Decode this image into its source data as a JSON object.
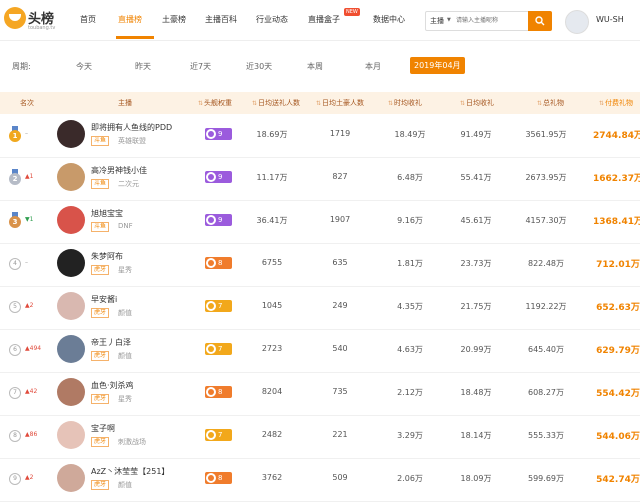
{
  "header": {
    "logo_name": "头榜",
    "logo_sub": "toubang.tv",
    "nav": [
      {
        "label": "首页",
        "active": false
      },
      {
        "label": "直播榜",
        "active": true
      },
      {
        "label": "土豪榜",
        "active": false
      },
      {
        "label": "主播百科",
        "active": false
      },
      {
        "label": "行业动态",
        "active": false
      },
      {
        "label": "直播盒子",
        "active": false,
        "badge": "NEW"
      },
      {
        "label": "数据中心",
        "active": false
      }
    ],
    "search": {
      "type": "主播",
      "placeholder": "请输入主播昵称"
    },
    "user_name": "WU-SH"
  },
  "period": {
    "label": "周期:",
    "options": [
      "今天",
      "昨天",
      "近7天",
      "近30天",
      "本周",
      "本月",
      "2019年04月"
    ],
    "selected_index": 6
  },
  "table": {
    "columns": [
      "名次",
      "主播",
      "头舰权重",
      "日均送礼人数",
      "日均土豪人数",
      "时均收礼",
      "日均收礼",
      "总礼物",
      "付费礼物"
    ],
    "rows": [
      {
        "rank": "1",
        "trend": "–",
        "trend_dir": "flat",
        "name": "即将拥有人鱼线的PDD",
        "platform": "斗鱼",
        "category": "英雄联盟",
        "weight": "9",
        "weight_color": "purple",
        "gift_users": "18.69万",
        "rich_users": "1719",
        "hourly": "18.49万",
        "daily": "91.49万",
        "total": "3561.95万",
        "paid": "2744.84万",
        "avatar_color": "#3a2a2a"
      },
      {
        "rank": "2",
        "trend": "1",
        "trend_dir": "up",
        "name": "高冷男神钱小佳",
        "platform": "斗鱼",
        "category": "二次元",
        "weight": "9",
        "weight_color": "purple",
        "gift_users": "11.17万",
        "rich_users": "827",
        "hourly": "6.48万",
        "daily": "55.41万",
        "total": "2673.95万",
        "paid": "1662.37万",
        "avatar_color": "#c89a6a"
      },
      {
        "rank": "3",
        "trend": "1",
        "trend_dir": "down",
        "name": "旭旭宝宝",
        "platform": "斗鱼",
        "category": "DNF",
        "weight": "9",
        "weight_color": "purple",
        "gift_users": "36.41万",
        "rich_users": "1907",
        "hourly": "9.16万",
        "daily": "45.61万",
        "total": "4157.30万",
        "paid": "1368.41万",
        "avatar_color": "#d8534a"
      },
      {
        "rank": "4",
        "trend": "–",
        "trend_dir": "flat",
        "name": "朱梦阿布",
        "platform": "虎牙",
        "category": "星秀",
        "weight": "8",
        "weight_color": "orange",
        "gift_users": "6755",
        "rich_users": "635",
        "hourly": "1.81万",
        "daily": "23.73万",
        "total": "822.48万",
        "paid": "712.01万",
        "avatar_color": "#222222"
      },
      {
        "rank": "5",
        "trend": "2",
        "trend_dir": "up",
        "name": "早安酱i",
        "platform": "虎牙",
        "category": "颜值",
        "weight": "7",
        "weight_color": "yellow",
        "gift_users": "1045",
        "rich_users": "249",
        "hourly": "4.35万",
        "daily": "21.75万",
        "total": "1192.22万",
        "paid": "652.63万",
        "avatar_color": "#d9b8b0"
      },
      {
        "rank": "6",
        "trend": "494",
        "trend_dir": "up",
        "name": "帝王丿白泽",
        "platform": "虎牙",
        "category": "颜值",
        "weight": "7",
        "weight_color": "yellow",
        "gift_users": "2723",
        "rich_users": "540",
        "hourly": "4.63万",
        "daily": "20.99万",
        "total": "645.40万",
        "paid": "629.79万",
        "avatar_color": "#6b7d96"
      },
      {
        "rank": "7",
        "trend": "42",
        "trend_dir": "up",
        "name": "血色·刘杀鸡",
        "platform": "虎牙",
        "category": "星秀",
        "weight": "8",
        "weight_color": "orange",
        "gift_users": "8204",
        "rich_users": "735",
        "hourly": "2.12万",
        "daily": "18.48万",
        "total": "608.27万",
        "paid": "554.42万",
        "avatar_color": "#b07a64"
      },
      {
        "rank": "8",
        "trend": "86",
        "trend_dir": "up",
        "name": "宝子啊",
        "platform": "虎牙",
        "category": "刺激战场",
        "weight": "7",
        "weight_color": "yellow",
        "gift_users": "2482",
        "rich_users": "221",
        "hourly": "3.29万",
        "daily": "18.14万",
        "total": "555.33万",
        "paid": "544.06万",
        "avatar_color": "#e6c3b8"
      },
      {
        "rank": "9",
        "trend": "2",
        "trend_dir": "up",
        "name": "AzZ丶沐莹莹【251】",
        "platform": "虎牙",
        "category": "颜值",
        "weight": "8",
        "weight_color": "orange",
        "gift_users": "3762",
        "rich_users": "509",
        "hourly": "2.06万",
        "daily": "18.09万",
        "total": "599.69万",
        "paid": "542.74万",
        "avatar_color": "#cfa99a"
      }
    ]
  }
}
